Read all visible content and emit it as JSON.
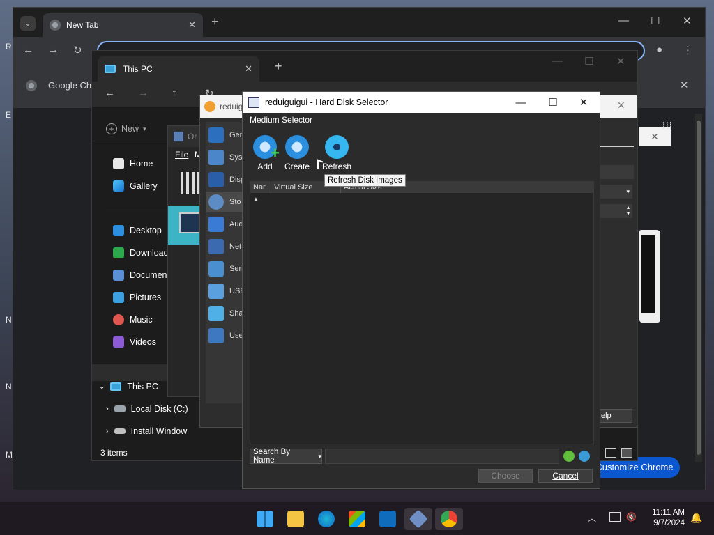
{
  "chrome": {
    "tab_title": "New Tab",
    "google_text": "Google Ch",
    "customize_label": "Customize Chrome"
  },
  "explorer": {
    "tab_title": "This PC",
    "new_label": "New",
    "sidebar": [
      {
        "label": "Home",
        "icon": "home-icon"
      },
      {
        "label": "Gallery",
        "icon": "gallery-icon"
      },
      {
        "label": "Desktop",
        "icon": "desktop-icon"
      },
      {
        "label": "Downloads",
        "icon": "downloads-icon"
      },
      {
        "label": "Documents",
        "icon": "documents-icon"
      },
      {
        "label": "Pictures",
        "icon": "pictures-icon"
      },
      {
        "label": "Music",
        "icon": "music-icon"
      },
      {
        "label": "Videos",
        "icon": "videos-icon"
      }
    ],
    "tree": [
      {
        "label": "This PC"
      },
      {
        "label": "Local Disk (C:)"
      },
      {
        "label": "Install Window"
      }
    ],
    "status": "3 items"
  },
  "vbox_manager": {
    "title": "Or",
    "menu_file": "File",
    "menu_m": "M"
  },
  "vbox_settings": {
    "title": "reduig",
    "items": [
      "Gen",
      "Sys",
      "Disp",
      "Sto",
      "Aud",
      "Net",
      "Seri",
      "USB",
      "Sha",
      "Use"
    ],
    "help_label": "elp"
  },
  "hds": {
    "title": "reduiguigui - Hard Disk Selector",
    "menu": "Medium Selector",
    "toolbar": {
      "add": "Add",
      "create": "Create",
      "refresh": "Refresh"
    },
    "tooltip": "Refresh Disk Images",
    "columns": [
      "Nar",
      "Virtual Size",
      "Actual Size"
    ],
    "search_mode": "Search By Name",
    "choose_label": "Choose",
    "cancel_label": "Cancel"
  },
  "taskbar": {
    "time": "11:11 AM",
    "date": "9/7/2024"
  }
}
